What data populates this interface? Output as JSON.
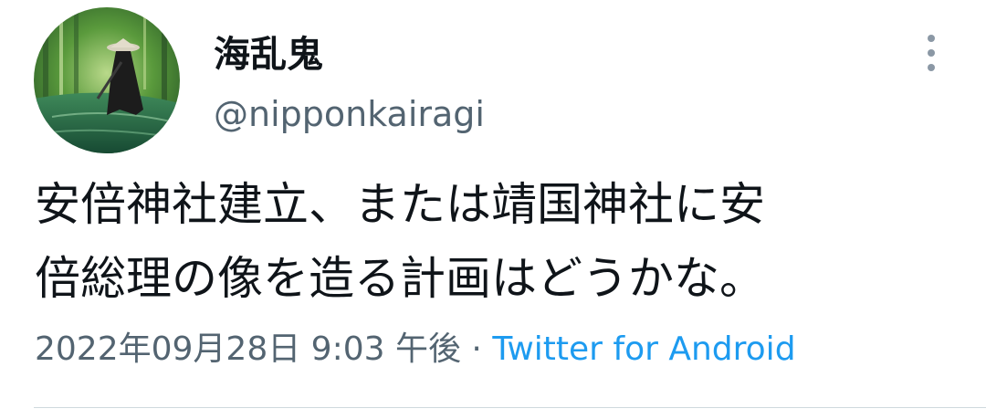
{
  "tweet": {
    "author": {
      "display_name": "海乱鬼",
      "handle": "@nipponkairagi",
      "avatar_icon": "avatar-image"
    },
    "more_icon": "more-vertical-icon",
    "text_lines": [
      "安倍神社建立、または靖国神社に安",
      "倍総理の像を造る計画はどうかな。"
    ],
    "timestamp": "2022年09月28日 9:03 午後",
    "separator": " · ",
    "source": "Twitter for Android",
    "colors": {
      "text": "#0f1419",
      "secondary": "#536471",
      "link": "#1d9bf0",
      "divider": "#cfd9de"
    }
  }
}
